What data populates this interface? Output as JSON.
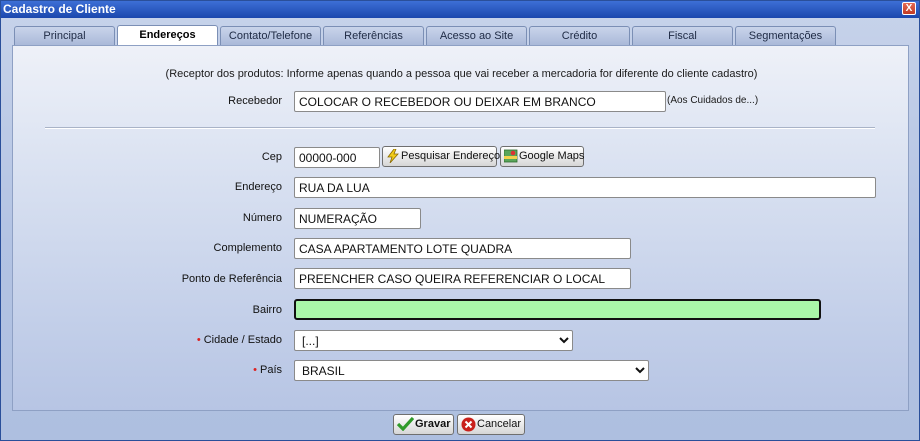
{
  "window": {
    "title": "Cadastro de Cliente",
    "close_label": "X"
  },
  "tabs": [
    {
      "label": "Principal"
    },
    {
      "label": "Endereços"
    },
    {
      "label": "Contato/Telefone"
    },
    {
      "label": "Referências"
    },
    {
      "label": "Acesso ao Site"
    },
    {
      "label": "Crédito"
    },
    {
      "label": "Fiscal"
    },
    {
      "label": "Segmentações"
    }
  ],
  "active_tab": "Endereços",
  "form": {
    "info_text": "(Receptor dos produtos: Informe apenas quando a pessoa que vai receber a mercadoria for diferente do cliente cadastro)",
    "recebedor": {
      "label": "Recebedor",
      "value": "COLOCAR O RECEBEDOR OU DEIXAR EM BRANCO",
      "note": "(Aos Cuidados de...)"
    },
    "cep": {
      "label": "Cep",
      "value": "00000-000"
    },
    "pesquisar_label": "Pesquisar Endereço",
    "google_maps_label": "Google Maps",
    "endereco": {
      "label": "Endereço",
      "value": "RUA DA LUA"
    },
    "numero": {
      "label": "Número",
      "value": "NUMERAÇÃO"
    },
    "complemento": {
      "label": "Complemento",
      "value": "CASA APARTAMENTO LOTE QUADRA"
    },
    "referencia": {
      "label": "Ponto de Referência",
      "value": "PREENCHER CASO QUEIRA REFERENCIAR O LOCAL"
    },
    "bairro": {
      "label": "Bairro",
      "value": ""
    },
    "cidade": {
      "label": "Cidade / Estado",
      "required_mark": "•",
      "selected": "[...]"
    },
    "pais": {
      "label": "País",
      "required_mark": "•",
      "selected": "BRASIL"
    }
  },
  "footer": {
    "save_label": "Gravar",
    "cancel_label": "Cancelar"
  }
}
